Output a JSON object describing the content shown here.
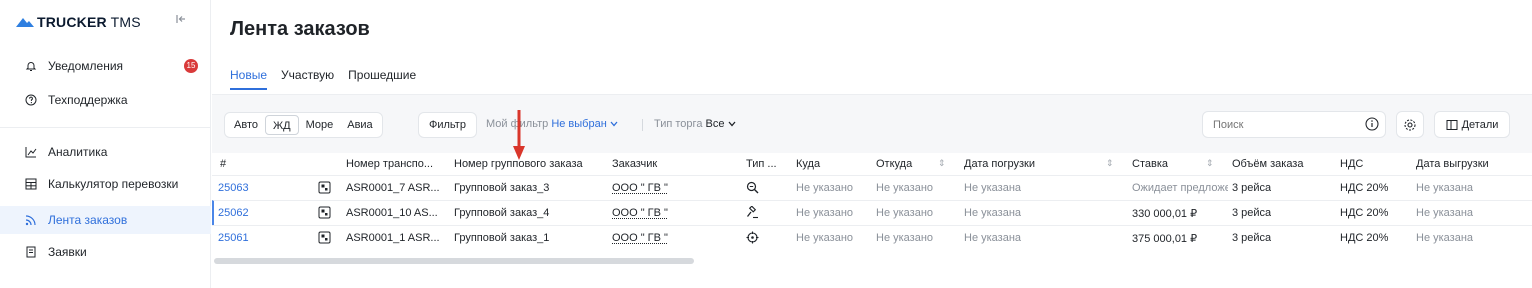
{
  "brand": {
    "name_bold": "TRUCKER",
    "name_light": " TMS"
  },
  "sidebar": {
    "items": [
      {
        "label": "Уведомления",
        "icon": "bell-icon",
        "badge": "15"
      },
      {
        "label": "Техподдержка",
        "icon": "help-circle-icon"
      },
      {
        "label": "Аналитика",
        "icon": "chart-line-icon"
      },
      {
        "label": "Калькулятор перевозки",
        "icon": "calculator-icon"
      },
      {
        "label": "Лента заказов",
        "icon": "feed-icon",
        "active": true
      },
      {
        "label": "Заявки",
        "icon": "document-icon"
      }
    ]
  },
  "page": {
    "title": "Лента заказов"
  },
  "tabs": [
    {
      "label": "Новые",
      "active": true
    },
    {
      "label": "Участвую"
    },
    {
      "label": "Прошедшие"
    }
  ],
  "toolbar": {
    "transport_modes": [
      "Авто",
      "ЖД",
      "Море",
      "Авиа"
    ],
    "active_mode": "ЖД",
    "filter_label": "Фильтр",
    "my_filter_label": "Мой фильтр ",
    "my_filter_value": "Не выбран",
    "trade_type_label": "Тип торга ",
    "trade_type_value": "Все",
    "search_placeholder": "Поиск",
    "details_label": "Детали"
  },
  "table": {
    "columns": [
      "#",
      "Номер транспо...",
      "Номер группового заказа",
      "Заказчик",
      "Тип ...",
      "Куда",
      "Откуда",
      "Дата погрузки",
      "Ставка",
      "Объём заказа",
      "НДС",
      "Дата выгрузки"
    ],
    "rows": [
      {
        "id": "25063",
        "transport_no": "ASR0001_7 ASR...",
        "group_order": "Групповой заказ_3",
        "customer": "ООО \" ГВ \"",
        "type_icon": "search-doc-icon",
        "to": "Не указано",
        "from": "Не указано",
        "load_date": "Не указана",
        "rate": "Ожидает предложений",
        "volume": "3 рейса",
        "vat": "НДС 20%",
        "unload_date": "Не указана"
      },
      {
        "id": "25062",
        "transport_no": "ASR0001_10 AS...",
        "group_order": "Групповой заказ_4",
        "customer": "ООО \" ГВ \"",
        "type_icon": "gavel-icon",
        "to": "Не указано",
        "from": "Не указано",
        "load_date": "Не указана",
        "rate": "330 000,01 ₽",
        "volume": "3 рейса",
        "vat": "НДС 20%",
        "unload_date": "Не указана"
      },
      {
        "id": "25061",
        "transport_no": "ASR0001_1 ASR...",
        "group_order": "Групповой заказ_1",
        "customer": "ООО \" ГВ \"",
        "type_icon": "target-icon",
        "to": "Не указано",
        "from": "Не указано",
        "load_date": "Не указана",
        "rate": "375 000,01 ₽",
        "volume": "3 рейса",
        "vat": "НДС 20%",
        "unload_date": "Не указана"
      }
    ]
  },
  "colors": {
    "accent": "#2f6fdb",
    "badge": "#d93a3a",
    "annotation_arrow": "#d9362b"
  }
}
